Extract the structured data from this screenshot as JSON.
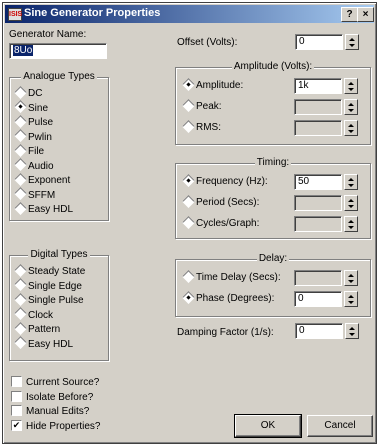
{
  "window": {
    "title": "Sine Generator Properties",
    "help_label": "?",
    "close_label": "×"
  },
  "generator_name": {
    "label": "Generator Name:",
    "value": "8Uo"
  },
  "analogue": {
    "title": "Analogue Types",
    "items": [
      {
        "label": "DC",
        "selected": false
      },
      {
        "label": "Sine",
        "selected": true
      },
      {
        "label": "Pulse",
        "selected": false
      },
      {
        "label": "Pwlin",
        "selected": false
      },
      {
        "label": "File",
        "selected": false
      },
      {
        "label": "Audio",
        "selected": false
      },
      {
        "label": "Exponent",
        "selected": false
      },
      {
        "label": "SFFM",
        "selected": false
      },
      {
        "label": "Easy HDL",
        "selected": false
      }
    ]
  },
  "digital": {
    "title": "Digital Types",
    "items": [
      {
        "label": "Steady State",
        "selected": false
      },
      {
        "label": "Single Edge",
        "selected": false
      },
      {
        "label": "Single Pulse",
        "selected": false
      },
      {
        "label": "Clock",
        "selected": false
      },
      {
        "label": "Pattern",
        "selected": false
      },
      {
        "label": "Easy HDL",
        "selected": false
      }
    ]
  },
  "options": [
    {
      "label": "Current Source?",
      "checked": false
    },
    {
      "label": "Isolate Before?",
      "checked": false
    },
    {
      "label": "Manual Edits?",
      "checked": false
    },
    {
      "label": "Hide Properties?",
      "checked": true
    }
  ],
  "offset": {
    "label": "Offset (Volts):",
    "value": "0"
  },
  "amplitude": {
    "title": "Amplitude (Volts):",
    "rows": [
      {
        "label": "Amplitude:",
        "value": "1k",
        "selected": true
      },
      {
        "label": "Peak:",
        "value": "",
        "selected": false
      },
      {
        "label": "RMS:",
        "value": "",
        "selected": false
      }
    ]
  },
  "timing": {
    "title": "Timing:",
    "rows": [
      {
        "label": "Frequency (Hz):",
        "value": "50",
        "selected": true
      },
      {
        "label": "Period (Secs):",
        "value": "",
        "selected": false
      },
      {
        "label": "Cycles/Graph:",
        "value": "",
        "selected": false
      }
    ]
  },
  "delay": {
    "title": "Delay:",
    "rows": [
      {
        "label": "Time Delay (Secs):",
        "value": "",
        "selected": false
      },
      {
        "label": "Phase (Degrees):",
        "value": "0",
        "selected": true
      }
    ]
  },
  "damping": {
    "label": "Damping Factor (1/s):",
    "value": "0"
  },
  "buttons": {
    "ok": "OK",
    "cancel": "Cancel"
  },
  "colors": {
    "title_start": "#0a246a",
    "title_end": "#a6caf0",
    "face": "#d4d0c8",
    "selection": "#0a246a"
  }
}
